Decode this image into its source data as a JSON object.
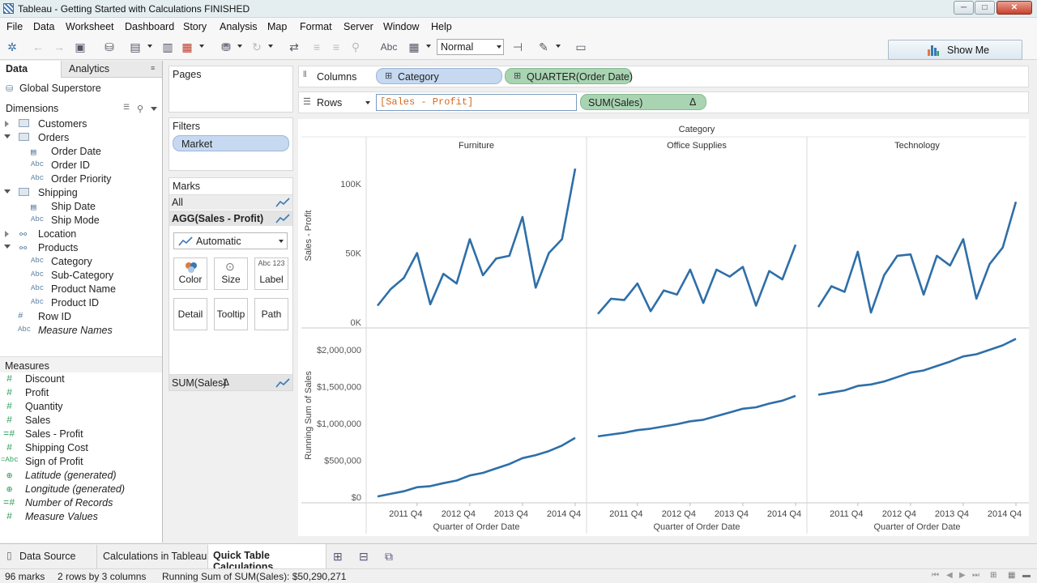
{
  "window": {
    "title": "Tableau - Getting Started with Calculations FINISHED",
    "minimize": "─",
    "maximize": "□",
    "close": "✕"
  },
  "menu": [
    "File",
    "Data",
    "Worksheet",
    "Dashboard",
    "Story",
    "Analysis",
    "Map",
    "Format",
    "Server",
    "Window",
    "Help"
  ],
  "toolbar": {
    "fit_mode": "Normal",
    "show_me": "Show Me",
    "abc_label": "Abc"
  },
  "left_pane": {
    "tabs": [
      "Data",
      "Analytics"
    ],
    "datasource": "Global Superstore",
    "dimensions_header": "Dimensions",
    "measures_header": "Measures",
    "dimensions": [
      {
        "label": "Customers",
        "type": "folder",
        "level": 0,
        "expanded": false
      },
      {
        "label": "Orders",
        "type": "folder",
        "level": 0,
        "expanded": true
      },
      {
        "label": "Order Date",
        "type": "date",
        "level": 1
      },
      {
        "label": "Order ID",
        "type": "abc",
        "level": 1
      },
      {
        "label": "Order Priority",
        "type": "abc",
        "level": 1
      },
      {
        "label": "Shipping",
        "type": "folder",
        "level": 0,
        "expanded": true
      },
      {
        "label": "Ship Date",
        "type": "date",
        "level": 1
      },
      {
        "label": "Ship Mode",
        "type": "abc",
        "level": 1
      },
      {
        "label": "Location",
        "type": "hierarchy",
        "level": 0,
        "expanded": false
      },
      {
        "label": "Products",
        "type": "hierarchy",
        "level": 0,
        "expanded": true
      },
      {
        "label": "Category",
        "type": "abc",
        "level": 1
      },
      {
        "label": "Sub-Category",
        "type": "abc",
        "level": 1
      },
      {
        "label": "Product Name",
        "type": "abc",
        "level": 1
      },
      {
        "label": "Product ID",
        "type": "abc",
        "level": 1
      },
      {
        "label": "Row ID",
        "type": "number",
        "level": 0
      },
      {
        "label": "Measure Names",
        "type": "abc",
        "level": 0,
        "italic": true
      }
    ],
    "measures": [
      {
        "label": "Discount",
        "type": "number"
      },
      {
        "label": "Profit",
        "type": "number"
      },
      {
        "label": "Quantity",
        "type": "number"
      },
      {
        "label": "Sales",
        "type": "number"
      },
      {
        "label": "Sales - Profit",
        "type": "calc-number"
      },
      {
        "label": "Shipping Cost",
        "type": "number"
      },
      {
        "label": "Sign of Profit",
        "type": "calc-abc"
      },
      {
        "label": "Latitude (generated)",
        "type": "geo",
        "italic": true
      },
      {
        "label": "Longitude (generated)",
        "type": "geo",
        "italic": true
      },
      {
        "label": "Number of Records",
        "type": "calc-number",
        "italic": true
      },
      {
        "label": "Measure Values",
        "type": "number",
        "italic": true
      }
    ]
  },
  "cards": {
    "pages": "Pages",
    "filters": "Filters",
    "filter_pills": [
      "Market"
    ],
    "marks": "Marks",
    "marks_all": "All",
    "marks_measure1": "AGG(Sales - Profit)",
    "mark_type": "Automatic",
    "mark_buttons": [
      "Color",
      "Size",
      "Label",
      "Detail",
      "Tooltip",
      "Path"
    ],
    "label_icon_text": "Abc 123",
    "marks_measure2": "SUM(Sales)",
    "delta": "Δ"
  },
  "shelves": {
    "columns_label": "Columns",
    "columns": [
      "Category",
      "QUARTER(Order Date)"
    ],
    "rows_label": "Rows",
    "rows_edit": "[Sales - Profit]",
    "rows_pill": "SUM(Sales)",
    "delta": "Δ"
  },
  "chart_data": {
    "type": "line",
    "header": "Category",
    "panes": [
      "Furniture",
      "Office Supplies",
      "Technology"
    ],
    "xlabel": "Quarter of Order Date",
    "x_ticks": [
      "2011 Q4",
      "2012 Q4",
      "2013 Q4",
      "2014 Q4"
    ],
    "x": [
      "2011 Q1",
      "2011 Q2",
      "2011 Q3",
      "2011 Q4",
      "2012 Q1",
      "2012 Q2",
      "2012 Q3",
      "2012 Q4",
      "2013 Q1",
      "2013 Q2",
      "2013 Q3",
      "2013 Q4",
      "2014 Q1",
      "2014 Q2",
      "2014 Q3",
      "2014 Q4"
    ],
    "rows": [
      {
        "ylabel": "Sales - Profit",
        "y_ticks": [
          "0K",
          "50K",
          "100K"
        ],
        "y_tick_values": [
          0,
          50000,
          100000
        ],
        "ylim": [
          0,
          120000
        ],
        "series": [
          {
            "pane": "Furniture",
            "values": [
              12000,
              24000,
              32000,
              50000,
              13000,
              35000,
              28000,
              60000,
              34000,
              46000,
              48000,
              76000,
              25000,
              50000,
              60000,
              111000
            ]
          },
          {
            "pane": "Office Supplies",
            "values": [
              6000,
              17000,
              16000,
              28000,
              8000,
              23000,
              20000,
              38000,
              14000,
              38000,
              33000,
              40000,
              12000,
              37000,
              31000,
              56000
            ]
          },
          {
            "pane": "Technology",
            "values": [
              11000,
              26000,
              22000,
              51000,
              7000,
              34000,
              48000,
              49000,
              20000,
              48000,
              41000,
              60000,
              17000,
              42000,
              54000,
              87000
            ]
          }
        ]
      },
      {
        "ylabel": "Running Sum of Sales",
        "y_ticks": [
          "$0",
          "$500,000",
          "$1,000,000",
          "$1,500,000",
          "$2,000,000"
        ],
        "y_tick_values": [
          0,
          500000,
          1000000,
          1500000,
          2000000
        ],
        "ylim": [
          0,
          2100000
        ],
        "series": [
          {
            "pane": "Furniture",
            "values": [
              10000,
              45000,
              80000,
              135000,
              150000,
              190000,
              225000,
              295000,
              330000,
              390000,
              450000,
              530000,
              570000,
              625000,
              700000,
              805000
            ]
          },
          {
            "pane": "Office Supplies",
            "values": [
              825000,
              850000,
              875000,
              910000,
              930000,
              960000,
              990000,
              1030000,
              1050000,
              1100000,
              1150000,
              1200000,
              1220000,
              1270000,
              1310000,
              1375000
            ]
          },
          {
            "pane": "Technology",
            "values": [
              1390000,
              1420000,
              1450000,
              1510000,
              1530000,
              1570000,
              1630000,
              1690000,
              1720000,
              1780000,
              1840000,
              1910000,
              1940000,
              2000000,
              2060000,
              2150000
            ]
          }
        ]
      }
    ],
    "line_color": "#2e6fa8"
  },
  "bottom_tabs": [
    "Data Source",
    "Calculations in Tableau",
    "Quick Table Calculations"
  ],
  "status": {
    "marks": "96 marks",
    "dims": "2 rows by 3 columns",
    "summary": "Running Sum of SUM(Sales): $50,290,271"
  }
}
